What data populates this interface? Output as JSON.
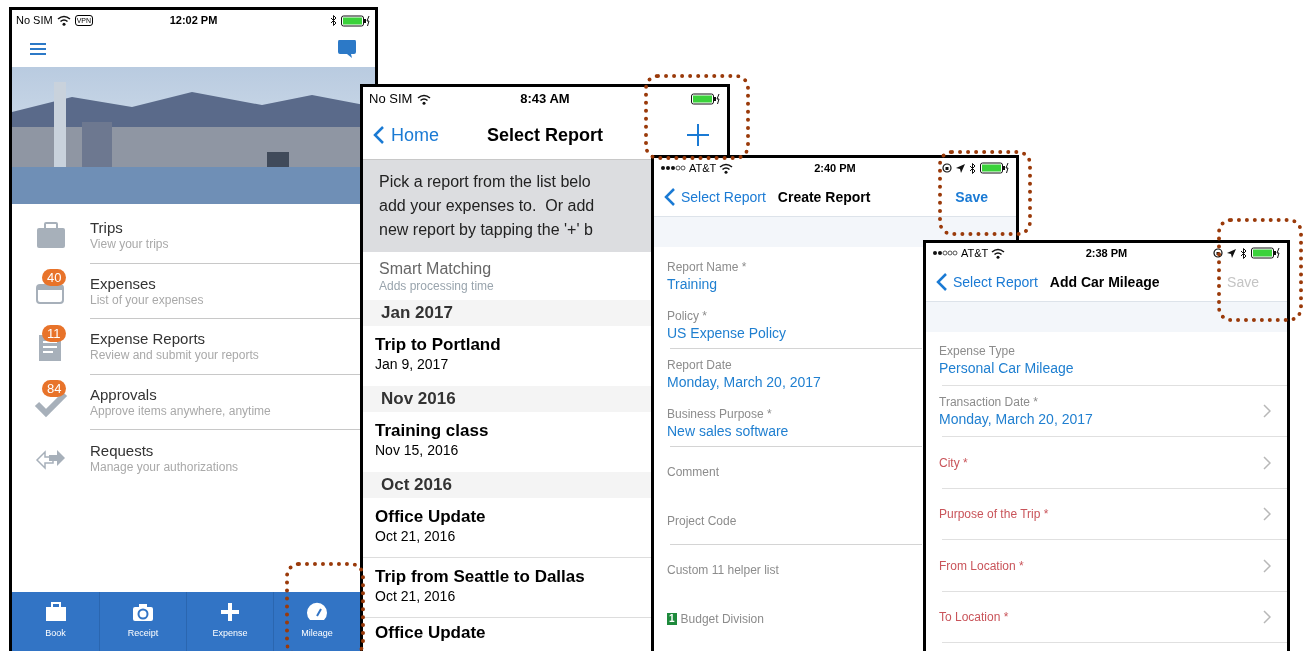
{
  "home_screen": {
    "status": {
      "carrier": "No SIM",
      "vpn": "VPN",
      "time": "12:02 PM"
    },
    "menu_items": [
      {
        "kind": "trips",
        "title": "Trips",
        "subtitle": "View your trips"
      },
      {
        "kind": "expenses",
        "title": "Expenses",
        "subtitle": "List of your expenses",
        "badge": "40"
      },
      {
        "kind": "reports",
        "title": "Expense Reports",
        "subtitle": "Review and submit your reports",
        "badge": "11"
      },
      {
        "kind": "approvals",
        "title": "Approvals",
        "subtitle": "Approve items anywhere, anytime",
        "badge": "84"
      },
      {
        "kind": "requests",
        "title": "Requests",
        "subtitle": "Manage your authorizations"
      }
    ],
    "tab_bar": [
      {
        "kind": "book",
        "label": "Book"
      },
      {
        "kind": "receipt",
        "label": "Receipt"
      },
      {
        "kind": "expense",
        "label": "Expense"
      },
      {
        "kind": "mileage",
        "label": "Mileage"
      }
    ]
  },
  "select_report_screen": {
    "status": {
      "carrier": "No SIM",
      "time": "8:43 AM"
    },
    "back": "Home",
    "title": "Select Report",
    "intro_lines": [
      "Pick a report from the list belo",
      "add your expenses to.  Or add",
      "new report by tapping the '+' b"
    ],
    "smart_matching": {
      "title": "Smart Matching",
      "subtitle": "Adds processing time"
    },
    "sections": [
      {
        "heading": "Jan 2017",
        "reports": [
          {
            "title": "Trip to Portland",
            "date": "Jan 9, 2017"
          }
        ]
      },
      {
        "heading": "Nov 2016",
        "reports": [
          {
            "title": "Training class",
            "date": "Nov 15, 2016"
          }
        ]
      },
      {
        "heading": "Oct 2016",
        "reports": [
          {
            "title": "Office Update",
            "date": "Oct 21, 2016"
          },
          {
            "title": "Trip from Seattle to Dallas",
            "date": "Oct 21, 2016"
          },
          {
            "title": "Office Update"
          }
        ]
      }
    ]
  },
  "create_report_screen": {
    "status": {
      "carrier": "AT&T",
      "time": "2:40 PM"
    },
    "back": "Select Report",
    "title": "Create Report",
    "save": {
      "label": "Save",
      "disabled": false
    },
    "fields": [
      {
        "label": "Report Name *",
        "value": "Training",
        "divider": false
      },
      {
        "label": "Policy *",
        "value": "US Expense Policy",
        "divider": true
      },
      {
        "label": "Report Date",
        "value": "Monday, March 20, 2017",
        "divider": false
      },
      {
        "label": "Business Purpose *",
        "value": "New sales software",
        "divider": true
      },
      {
        "label": "Comment",
        "divider": false
      },
      {
        "label": "Project Code",
        "divider": true
      },
      {
        "label": "Custom 11 helper list",
        "divider": false
      },
      {
        "label": "Budget Division",
        "badge": "1",
        "divider": false
      }
    ]
  },
  "add_car_mileage_screen": {
    "status": {
      "carrier": "AT&T",
      "time": "2:38 PM"
    },
    "back": "Select Report",
    "title": "Add Car Mileage",
    "save": {
      "label": "Save",
      "disabled": true
    },
    "fields": [
      {
        "label": "Expense Type",
        "value": "Personal Car Mileage",
        "required_missing": false,
        "chevron": false
      },
      {
        "label": "Transaction Date *",
        "value": "Monday, March 20, 2017",
        "required_missing": false,
        "chevron": true
      },
      {
        "label": "City *",
        "required_missing": true,
        "chevron": true
      },
      {
        "label": "Purpose of the Trip *",
        "required_missing": true,
        "chevron": true
      },
      {
        "label": "From Location *",
        "required_missing": true,
        "chevron": true
      },
      {
        "label": "To Location *",
        "required_missing": true,
        "chevron": true
      }
    ]
  }
}
